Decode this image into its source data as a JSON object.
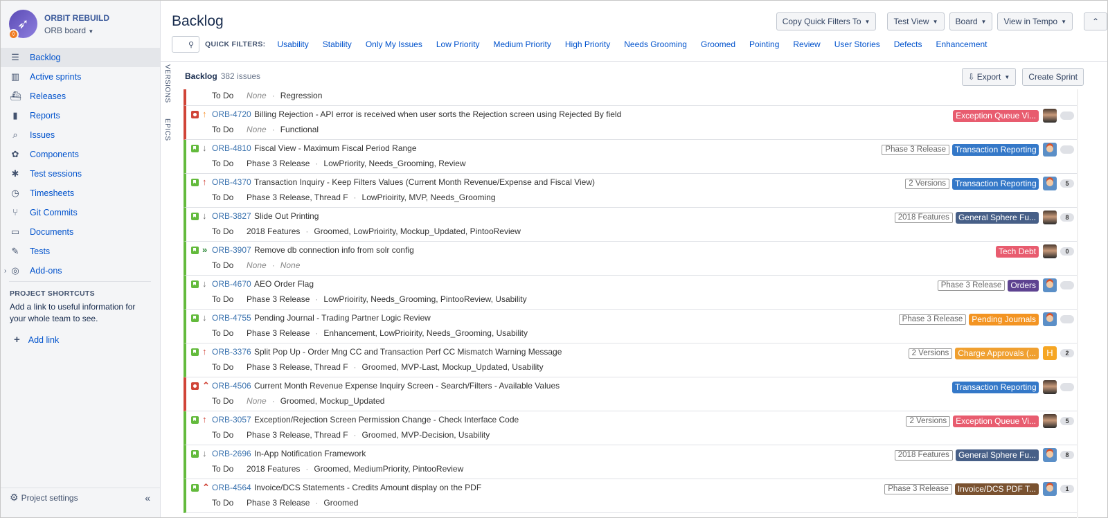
{
  "project": {
    "name": "ORBIT REBUILD",
    "board": "ORB board"
  },
  "nav": [
    {
      "label": "Backlog",
      "icon": "backlog-icon",
      "glyph": "☰"
    },
    {
      "label": "Active sprints",
      "icon": "active-sprints-icon",
      "glyph": "▥"
    },
    {
      "label": "Releases",
      "icon": "releases-icon",
      "glyph": "⛴"
    },
    {
      "label": "Reports",
      "icon": "reports-icon",
      "glyph": "▮"
    },
    {
      "label": "Issues",
      "icon": "issues-icon",
      "glyph": "⌕"
    },
    {
      "label": "Components",
      "icon": "components-icon",
      "glyph": "✿"
    },
    {
      "label": "Test sessions",
      "icon": "test-sessions-icon",
      "glyph": "✱"
    },
    {
      "label": "Timesheets",
      "icon": "timesheets-icon",
      "glyph": "◷"
    },
    {
      "label": "Git Commits",
      "icon": "git-commits-icon",
      "glyph": "⑂"
    },
    {
      "label": "Documents",
      "icon": "documents-icon",
      "glyph": "▭"
    },
    {
      "label": "Tests",
      "icon": "tests-icon",
      "glyph": "✎"
    },
    {
      "label": "Add-ons",
      "icon": "add-ons-icon",
      "glyph": "◎"
    }
  ],
  "shortcuts": {
    "heading": "PROJECT SHORTCUTS",
    "text": "Add a link to useful information for your whole team to see.",
    "add": "Add link"
  },
  "settings": {
    "label": "Project settings"
  },
  "header": {
    "title": "Backlog",
    "buttons": [
      "Copy Quick Filters To",
      "Test View",
      "Board",
      "View in Tempo"
    ]
  },
  "quick_filters": {
    "label": "QUICK FILTERS:",
    "items": [
      "Usability",
      "Stability",
      "Only My Issues",
      "Low Priority",
      "Medium Priority",
      "High Priority",
      "Needs Grooming",
      "Groomed",
      "Pointing",
      "Review",
      "User Stories",
      "Defects",
      "Enhancement"
    ]
  },
  "side_tabs": {
    "versions": "VERSIONS",
    "epics": "EPICS"
  },
  "backlog": {
    "title": "Backlog",
    "count": "382 issues",
    "export": "Export",
    "create": "Create Sprint"
  },
  "partial_row": {
    "status": "To Do",
    "version": "None",
    "labels": "Regression"
  },
  "issues": [
    {
      "type": "bug",
      "prio": "upo",
      "arrow": "↑",
      "key": "ORB-4720",
      "summary": "Billing Rejection - API error is received when user sorts the Rejection screen using Rejected By field",
      "status": "To Do",
      "version": "None",
      "labels": "Functional",
      "fixver": "",
      "epic": "Exception Queue Vi...",
      "epic_color": "#e85c6f",
      "avatar": "photo",
      "points": ""
    },
    {
      "type": "story",
      "prio": "down",
      "arrow": "↓",
      "key": "ORB-4810",
      "summary": "Fiscal View - Maximum Fiscal Period Range",
      "status": "To Do",
      "version": "Phase 3 Release",
      "labels": "LowPriority, Needs_Grooming, Review",
      "fixver": "Phase 3 Release",
      "epic": "Transaction Reporting",
      "epic_color": "#3478c8",
      "avatar": "cartoon",
      "points": ""
    },
    {
      "type": "story",
      "prio": "up",
      "arrow": "↑",
      "key": "ORB-4370",
      "summary": "Transaction Inquiry - Keep Filters Values (Current Month Revenue/Expense and Fiscal View)",
      "status": "To Do",
      "version": "Phase 3 Release, Thread F",
      "labels": "LowPrioirity, MVP, Needs_Grooming",
      "fixver": "2 Versions",
      "epic": "Transaction Reporting",
      "epic_color": "#3478c8",
      "avatar": "cartoon",
      "points": "5"
    },
    {
      "type": "story",
      "prio": "down",
      "arrow": "↓",
      "key": "ORB-3827",
      "summary": "Slide Out Printing",
      "status": "To Do",
      "version": "2018 Features",
      "labels": "Groomed, LowPrioirity, Mockup_Updated, PintooReview",
      "fixver": "2018 Features",
      "epic": "General Sphere Fu...",
      "epic_color": "#475f87",
      "avatar": "photo",
      "points": "8"
    },
    {
      "type": "story",
      "prio": "low2",
      "arrow": "»",
      "key": "ORB-3907",
      "summary": "Remove db connection info from solr config",
      "status": "To Do",
      "version": "None",
      "labels": "None",
      "fixver": "",
      "epic": "Tech Debt",
      "epic_color": "#e85c6f",
      "avatar": "photo",
      "points": "0"
    },
    {
      "type": "story",
      "prio": "down",
      "arrow": "↓",
      "key": "ORB-4670",
      "summary": "AEO Order Flag",
      "status": "To Do",
      "version": "Phase 3 Release",
      "labels": "LowPrioirity, Needs_Grooming, PintooReview, Usability",
      "fixver": "Phase 3 Release",
      "epic": "Orders",
      "epic_color": "#5e4391",
      "avatar": "cartoon",
      "points": ""
    },
    {
      "type": "story",
      "prio": "down",
      "arrow": "↓",
      "key": "ORB-4755",
      "summary": "Pending Journal - Trading Partner Logic Review",
      "status": "To Do",
      "version": "Phase 3 Release",
      "labels": "Enhancement, LowPrioirity, Needs_Grooming, Usability",
      "fixver": "Phase 3 Release",
      "epic": "Pending Journals",
      "epic_color": "#f39422",
      "avatar": "cartoon",
      "points": ""
    },
    {
      "type": "story",
      "prio": "up",
      "arrow": "↑",
      "key": "ORB-3376",
      "summary": "Split Pop Up - Order Mng CC and Transaction Perf CC Mismatch Warning Message",
      "status": "To Do",
      "version": "Phase 3 Release, Thread F",
      "labels": "Groomed, MVP-Last, Mockup_Updated, Usability",
      "fixver": "2 Versions",
      "epic": "Charge Approvals (...",
      "epic_color": "#f0a030",
      "avatar": "letter",
      "avatar_letter": "H",
      "points": "2"
    },
    {
      "type": "bug",
      "prio": "hi",
      "arrow": "⌃",
      "key": "ORB-4506",
      "summary": "Current Month Revenue Expense Inquiry Screen - Search/Filters - Available Values",
      "status": "To Do",
      "version": "None",
      "labels": "Groomed, Mockup_Updated",
      "fixver": "",
      "epic": "Transaction Reporting",
      "epic_color": "#3478c8",
      "avatar": "photo",
      "points": ""
    },
    {
      "type": "story",
      "prio": "up",
      "arrow": "↑",
      "key": "ORB-3057",
      "summary": "Exception/Rejection Screen Permission Change - Check Interface Code",
      "status": "To Do",
      "version": "Phase 3 Release, Thread F",
      "labels": "Groomed, MVP-Decision, Usability",
      "fixver": "2 Versions",
      "epic": "Exception Queue Vi...",
      "epic_color": "#e85c6f",
      "avatar": "photo",
      "points": "5"
    },
    {
      "type": "story",
      "prio": "down",
      "arrow": "↓",
      "key": "ORB-2696",
      "summary": "In-App Notification Framework",
      "status": "To Do",
      "version": "2018 Features",
      "labels": "Groomed, MediumPriority, PintooReview",
      "fixver": "2018 Features",
      "epic": "General Sphere Fu...",
      "epic_color": "#475f87",
      "avatar": "cartoon",
      "points": "8"
    },
    {
      "type": "story",
      "prio": "hi",
      "arrow": "⌃",
      "key": "ORB-4564",
      "summary": "Invoice/DCS Statements - Credits Amount display on the PDF",
      "status": "To Do",
      "version": "Phase 3 Release",
      "labels": "Groomed",
      "fixver": "Phase 3 Release",
      "epic": "Invoice/DCS PDF T...",
      "epic_color": "#7a5230",
      "avatar": "cartoon",
      "points": "1"
    }
  ]
}
